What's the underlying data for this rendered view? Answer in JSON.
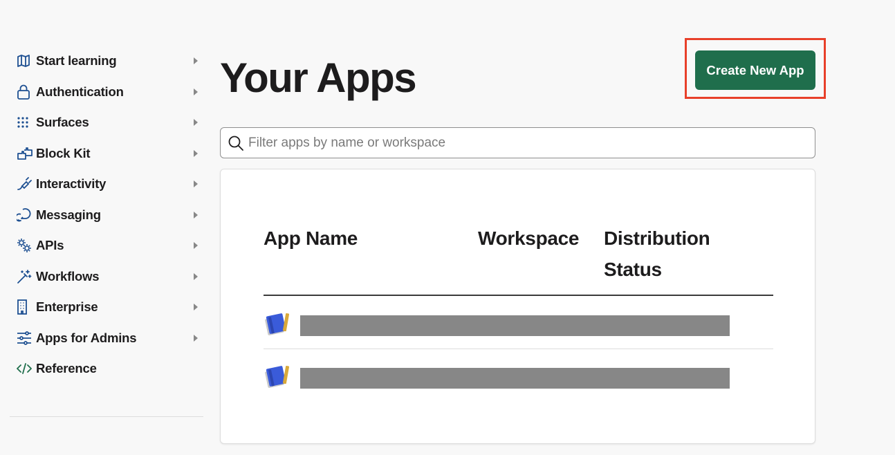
{
  "sidebar": {
    "items": [
      {
        "label": "Start learning",
        "icon": "map-icon"
      },
      {
        "label": "Authentication",
        "icon": "lock-icon"
      },
      {
        "label": "Surfaces",
        "icon": "grid-dots-icon"
      },
      {
        "label": "Block Kit",
        "icon": "blocks-icon"
      },
      {
        "label": "Interactivity",
        "icon": "plug-icon"
      },
      {
        "label": "Messaging",
        "icon": "chat-bubbles-icon"
      },
      {
        "label": "APIs",
        "icon": "gears-icon"
      },
      {
        "label": "Workflows",
        "icon": "magic-wand-icon"
      },
      {
        "label": "Enterprise",
        "icon": "building-icon"
      },
      {
        "label": "Apps for Admins",
        "icon": "sliders-icon"
      },
      {
        "label": "Reference",
        "icon": "code-icon"
      }
    ]
  },
  "main": {
    "title": "Your Apps",
    "create_button": "Create New App",
    "search": {
      "placeholder": "Filter apps by name or workspace",
      "value": ""
    },
    "table": {
      "columns": [
        "App Name",
        "Workspace",
        "Distribution Status"
      ]
    }
  },
  "colors": {
    "primary": "#1f6e4c",
    "highlight": "#e8402a",
    "icon_blue": "#1d4f91",
    "redaction": "#878787"
  }
}
